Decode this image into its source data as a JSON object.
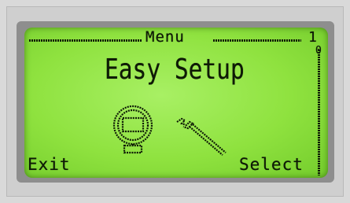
{
  "display": {
    "header_title": "Menu",
    "page_number": "1",
    "scroll_top_marker": "0",
    "title": "Easy Setup",
    "soft_keys": {
      "left": "Exit",
      "right": "Select"
    }
  },
  "icons": {
    "main": "device-with-wrench-icon"
  },
  "colors": {
    "lcd_background": "#8fe23f",
    "lcd_pixel": "#0e1a06",
    "bezel": "#cfcfcf"
  }
}
